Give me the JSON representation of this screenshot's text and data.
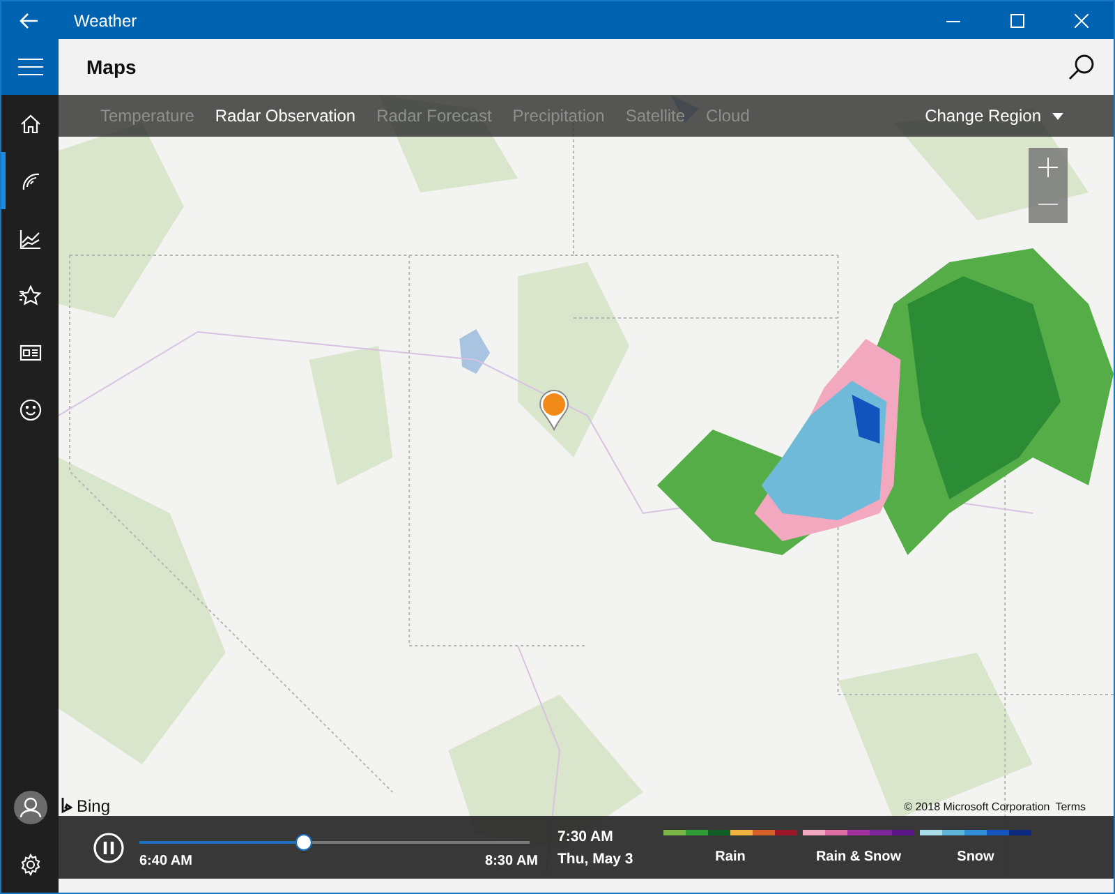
{
  "window": {
    "title": "Weather"
  },
  "nav": {
    "items": [
      {
        "selected": false
      },
      {
        "selected": true
      },
      {
        "selected": false
      },
      {
        "selected": false
      },
      {
        "selected": false
      },
      {
        "selected": false
      }
    ]
  },
  "header": {
    "title": "Maps"
  },
  "tabs": [
    {
      "label": "Temperature",
      "selected": false
    },
    {
      "label": "Radar Observation",
      "selected": true
    },
    {
      "label": "Radar Forecast",
      "selected": false
    },
    {
      "label": "Precipitation",
      "selected": false
    },
    {
      "label": "Satellite",
      "selected": false
    },
    {
      "label": "Cloud",
      "selected": false
    }
  ],
  "change_region": "Change Region",
  "map": {
    "brand": "Bing",
    "copyright": "© 2018 Microsoft Corporation",
    "terms": "Terms"
  },
  "timeline": {
    "playing": true,
    "level": 0.41,
    "start": "6:40 AM",
    "end": "8:30 AM",
    "time": "7:30 AM",
    "date": "Thu, May 3"
  },
  "legend": [
    {
      "label": "Rain",
      "swatches": [
        {
          "color": "#7ab648"
        },
        {
          "color": "#2e9b35"
        },
        {
          "color": "#0f5f27"
        },
        {
          "color": "#efb53f"
        },
        {
          "color": "#d6602a"
        },
        {
          "color": "#9c1529"
        }
      ]
    },
    {
      "label": "Rain & Snow",
      "swatches": [
        {
          "color": "#f2a9bf"
        },
        {
          "color": "#dd6ea6"
        },
        {
          "color": "#a42f9e"
        },
        {
          "color": "#7d2499"
        },
        {
          "color": "#5a1589"
        }
      ]
    },
    {
      "label": "Snow",
      "swatches": [
        {
          "color": "#a9dbe8"
        },
        {
          "color": "#5fb6d6"
        },
        {
          "color": "#2f8fd7"
        },
        {
          "color": "#1253bd"
        },
        {
          "color": "#0b2a7f"
        }
      ]
    }
  ]
}
